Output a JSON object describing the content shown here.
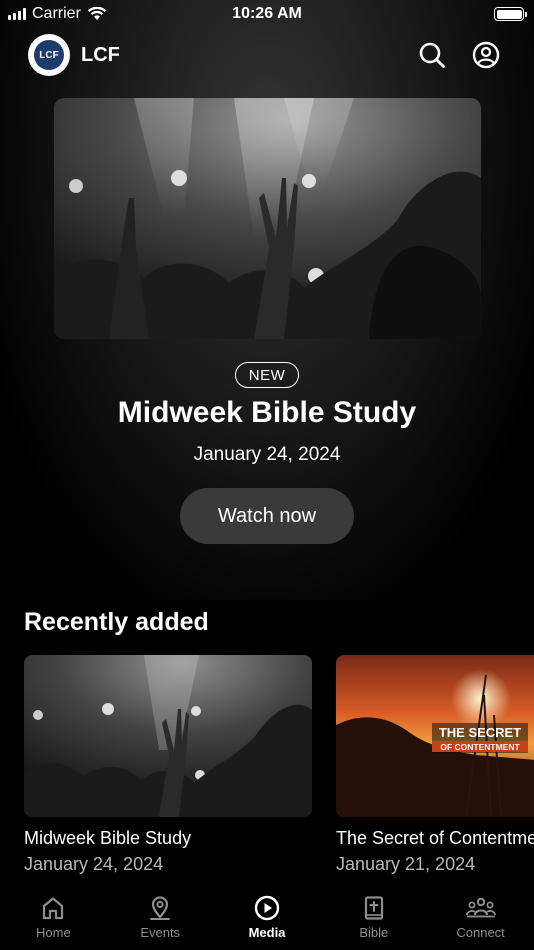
{
  "status_bar": {
    "carrier": "Carrier",
    "time": "10:26 AM"
  },
  "header": {
    "logo_text": "LCF",
    "brand_name": "LCF",
    "icons": [
      "search-icon",
      "account-icon"
    ]
  },
  "hero": {
    "badge": "NEW",
    "title": "Midweek Bible Study",
    "date": "January 24, 2024",
    "button_label": "Watch now"
  },
  "recent": {
    "section_title": "Recently added",
    "items": [
      {
        "title": "Midweek Bible Study",
        "date": "January 24, 2024"
      },
      {
        "title": "The Secret of Contentment",
        "date": "January 21, 2024",
        "thumb_title": "THE SECRET",
        "thumb_subtitle": "OF CONTENTMENT"
      }
    ]
  },
  "tabs": [
    {
      "label": "Home",
      "icon": "home-icon",
      "active": false
    },
    {
      "label": "Events",
      "icon": "location-pin-icon",
      "active": false
    },
    {
      "label": "Media",
      "icon": "play-circle-icon",
      "active": true
    },
    {
      "label": "Bible",
      "icon": "bible-icon",
      "active": false
    },
    {
      "label": "Connect",
      "icon": "people-icon",
      "active": false
    }
  ],
  "colors": {
    "background": "#000000",
    "button": "#3a3a3a",
    "tab_inactive": "#8e8e8e",
    "tab_active": "#ffffff"
  }
}
